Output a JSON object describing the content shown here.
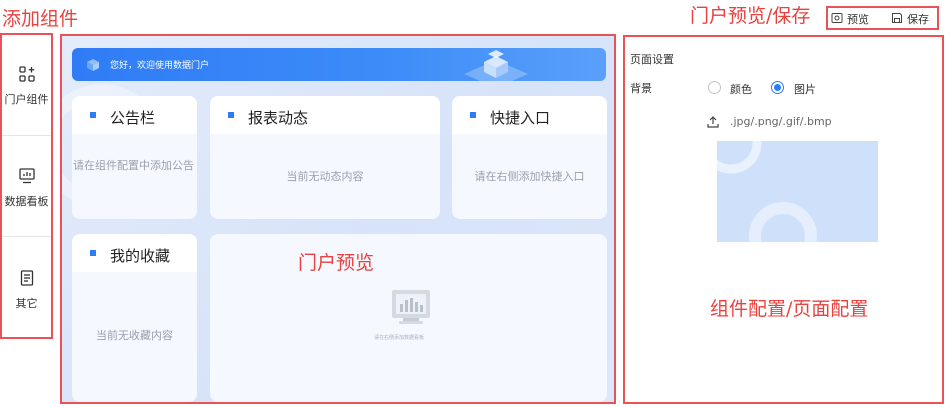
{
  "annotations": {
    "add_components": "添加组件",
    "portal_preview_save": "门户预览/保存",
    "portal_preview": "门户预览",
    "component_page_config": "组件配置/页面配置"
  },
  "palette": {
    "items": [
      {
        "label": "门户组件",
        "icon": "grid-plus-icon"
      },
      {
        "label": "数据看板",
        "icon": "monitor-chart-icon"
      },
      {
        "label": "其它",
        "icon": "document-icon"
      }
    ]
  },
  "top_actions": {
    "preview_label": "预览",
    "save_label": "保存"
  },
  "canvas": {
    "banner_text": "您好，欢迎使用数据门户",
    "cards": [
      {
        "title": "公告栏",
        "body": "请在组件配置中添加公告"
      },
      {
        "title": "报表动态",
        "body": "当前无动态内容"
      },
      {
        "title": "快捷入口",
        "body": "请在右侧添加快捷入口"
      },
      {
        "title": "我的收藏",
        "body": "当前无收藏内容"
      }
    ],
    "board_placeholder": "请在右侧添加数据看板"
  },
  "settings": {
    "section_title": "页面设置",
    "background_label": "背景",
    "options": [
      {
        "label": "颜色",
        "selected": false
      },
      {
        "label": "图片",
        "selected": true
      }
    ],
    "upload_hint": ".jpg/.png/.gif/.bmp"
  },
  "colors": {
    "accent": "#2d7cf6",
    "annotation": "#e8423f"
  }
}
